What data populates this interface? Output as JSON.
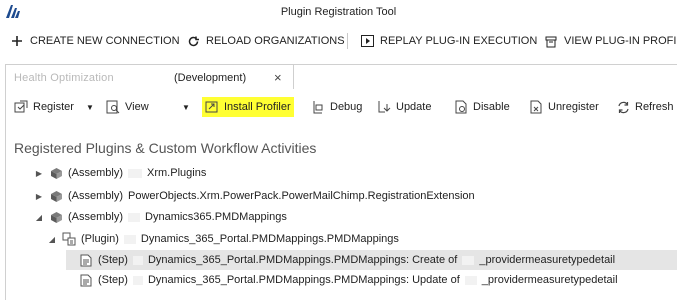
{
  "window": {
    "title": "Plugin Registration Tool"
  },
  "command_bar": {
    "create_connection": "CREATE NEW CONNECTION",
    "reload_organizations": "RELOAD ORGANIZATIONS",
    "replay_execution": "REPLAY PLUG-IN EXECUTION",
    "view_profile": "VIEW PLUG-IN PROFILI"
  },
  "tab": {
    "org_name": "Health Optimization",
    "environment": "(Development)",
    "close": "×"
  },
  "toolbar": {
    "register": "Register",
    "view": "View",
    "install_profiler": "Install Profiler",
    "debug": "Debug",
    "update": "Update",
    "disable": "Disable",
    "unregister": "Unregister",
    "refresh": "Refresh"
  },
  "section": {
    "title": "Registered Plugins & Custom Workflow Activities"
  },
  "tree": {
    "assembly_1": {
      "kind": "(Assembly)",
      "name": "Xrm.Plugins"
    },
    "assembly_2": {
      "kind": "(Assembly)",
      "name": "PowerObjects.Xrm.PowerPack.PowerMailChimp.RegistrationExtension"
    },
    "assembly_3": {
      "kind": "(Assembly)",
      "name": "Dynamics365.PMDMappings"
    },
    "plugin_1": {
      "kind": "(Plugin)",
      "name": "Dynamics_365_Portal.PMDMappings.PMDMappings"
    },
    "step_1": {
      "kind": "(Step)",
      "name_a": "Dynamics_365_Portal.PMDMappings.PMDMappings: Create of",
      "name_b": "_providermeasuretypedetail"
    },
    "step_2": {
      "kind": "(Step)",
      "name_a": "Dynamics_365_Portal.PMDMappings.PMDMappings: Update of",
      "name_b": "_providermeasuretypedetail"
    }
  },
  "colors": {
    "highlight": "#ffff33",
    "selected_row": "#e5e5e5",
    "text": "#222222"
  }
}
